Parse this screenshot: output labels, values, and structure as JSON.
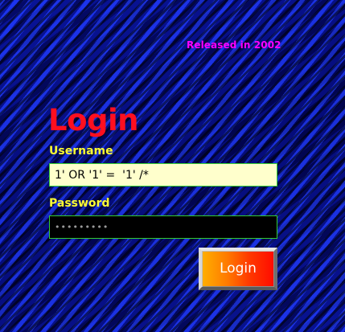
{
  "header": {
    "release_note": "Released in 2002"
  },
  "form": {
    "title": "Login",
    "username_label": "Username",
    "username_value": "1' OR '1' =  '1' /*",
    "password_label": "Password",
    "password_value": "•••••••••",
    "submit_label": "Login"
  },
  "colors": {
    "background": "#0a12b8",
    "release_note": "#ff00ff",
    "title": "#ff0f1f",
    "labels": "#ffff33",
    "username_field": "#ffffcc",
    "password_field": "#000000",
    "field_border": "#33cc33"
  }
}
